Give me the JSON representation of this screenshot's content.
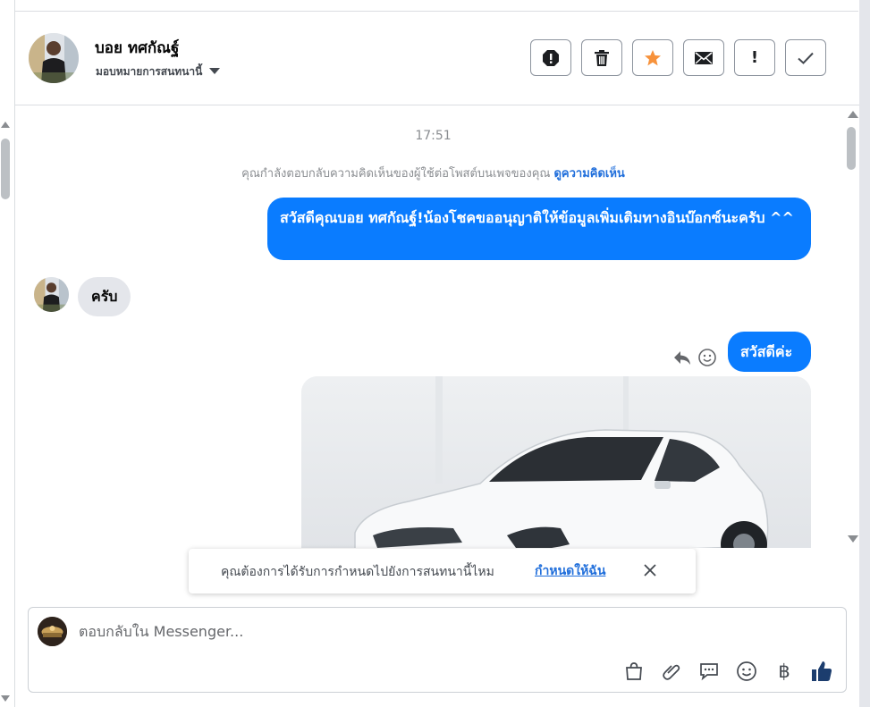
{
  "header": {
    "user_name": "บอย ทศกัณฐ์",
    "assign_label": "มอบหมายการสนทนานี้",
    "actions": [
      "spam-icon",
      "trash-icon",
      "star-icon",
      "mail-icon",
      "exclamation-icon",
      "check-icon"
    ],
    "exclaim_glyph": "!"
  },
  "chat": {
    "timestamp": "17:51",
    "context_text": "คุณกำลังตอบกลับความคิดเห็นของผู้ใช้ต่อโพสต์บนเพจของคุณ",
    "context_link": "ดูความคิดเห็น",
    "messages": [
      {
        "from": "page",
        "text": "สวัสดีคุณบอย ทศกัณฐ์!น้องโชคขออนุญาติให้ข้อมูลเพิ่มเติมทางอินบ๊อกซ์นะครับ ^^"
      },
      {
        "from": "user",
        "text": "ครับ"
      },
      {
        "from": "page",
        "text": "สวัสดีค่ะ"
      }
    ]
  },
  "notice": {
    "question": "คุณต้องการได้รับการกำหนดไปยังการสนทนานี้ไหม",
    "action": "กำหนดให้ฉัน"
  },
  "composer": {
    "placeholder": "ตอบกลับใน Messenger...",
    "tools": [
      "shopping-bag-icon",
      "paperclip-icon",
      "saved-reply-icon",
      "emoji-icon",
      "baht-icon",
      "like-icon"
    ],
    "baht_glyph": "฿"
  },
  "colors": {
    "accent": "#0a7cff",
    "link": "#216fdb",
    "star": "#f7923b"
  }
}
